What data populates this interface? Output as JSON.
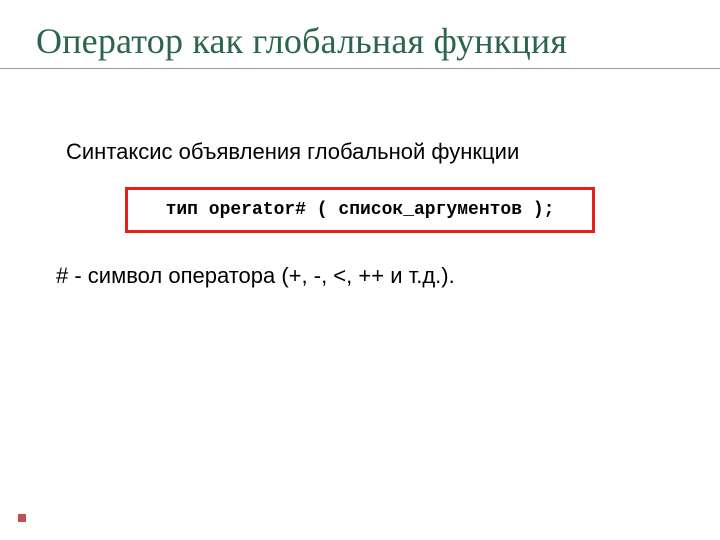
{
  "title": "Оператор как глобальная функция",
  "subhead": "Синтаксис объявления глобальной функции",
  "code": "тип operator# ( список_аргументов );",
  "note": "#  - символ оператора (+, -, <, ++ и т.д.).",
  "colors": {
    "title": "#2b654b",
    "box_border": "#e6211a",
    "accent_square": "#c0504d"
  }
}
